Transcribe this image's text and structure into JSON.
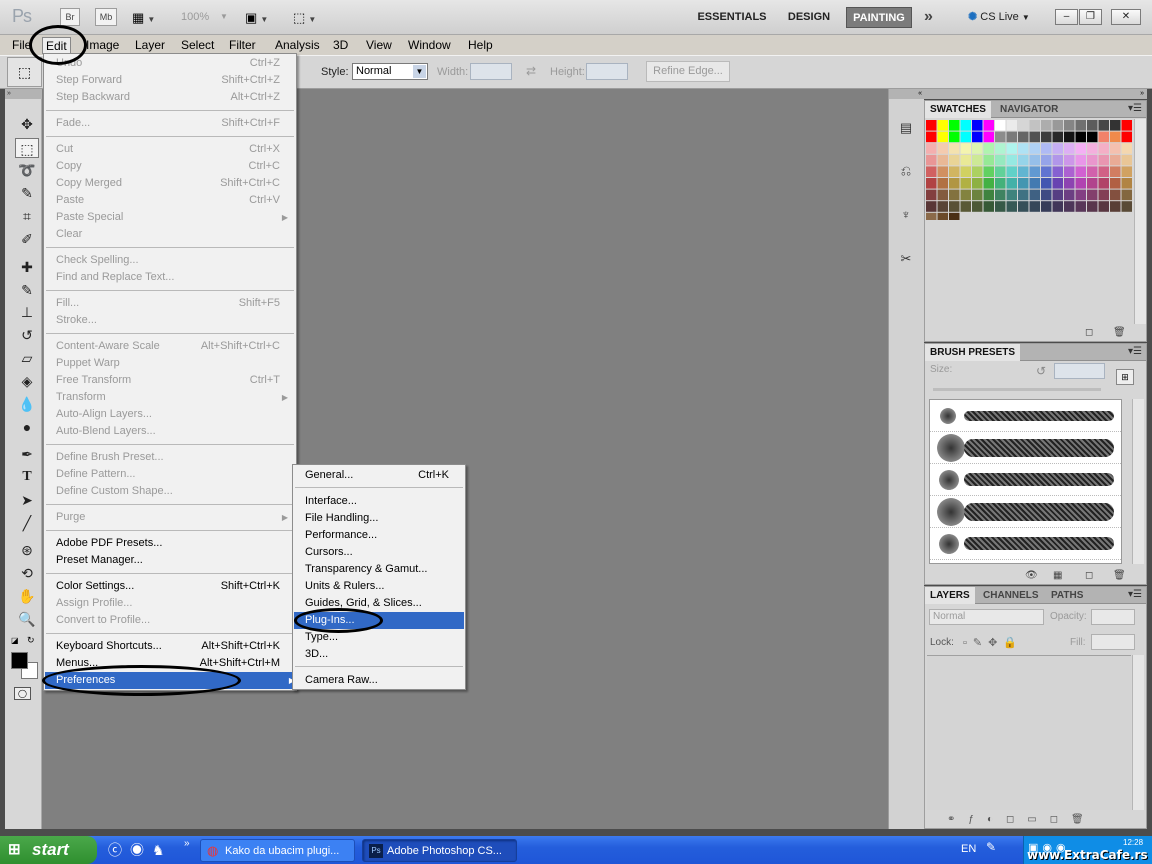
{
  "app": {
    "logo": "Ps",
    "br": "Br",
    "mb": "Mb",
    "zoom": "100%",
    "workspaces": [
      "ESSENTIALS",
      "DESIGN",
      "PAINTING"
    ],
    "active_workspace": "PAINTING",
    "more": "»",
    "cs_live": "CS Live",
    "window_controls": [
      "–",
      "❐",
      "✕"
    ]
  },
  "menubar": [
    "File",
    "Edit",
    "Image",
    "Layer",
    "Select",
    "Filter",
    "Analysis",
    "3D",
    "View",
    "Window",
    "Help"
  ],
  "options": {
    "style_label": "Style:",
    "style_value": "Normal",
    "width_label": "Width:",
    "height_label": "Height:",
    "refine": "Refine Edge..."
  },
  "edit_menu": [
    {
      "label": "Undo",
      "shortcut": "Ctrl+Z",
      "disabled": true
    },
    {
      "label": "Step Forward",
      "shortcut": "Shift+Ctrl+Z",
      "disabled": true
    },
    {
      "label": "Step Backward",
      "shortcut": "Alt+Ctrl+Z",
      "disabled": true
    },
    {
      "label": "Fade...",
      "shortcut": "Shift+Ctrl+F",
      "disabled": true
    },
    {
      "label": "Cut",
      "shortcut": "Ctrl+X",
      "disabled": true
    },
    {
      "label": "Copy",
      "shortcut": "Ctrl+C",
      "disabled": true
    },
    {
      "label": "Copy Merged",
      "shortcut": "Shift+Ctrl+C",
      "disabled": true
    },
    {
      "label": "Paste",
      "shortcut": "Ctrl+V",
      "disabled": true
    },
    {
      "label": "Paste Special",
      "shortcut": "",
      "disabled": true
    },
    {
      "label": "Clear",
      "shortcut": "",
      "disabled": true
    },
    {
      "label": "Check Spelling...",
      "shortcut": "",
      "disabled": true
    },
    {
      "label": "Find and Replace Text...",
      "shortcut": "",
      "disabled": true
    },
    {
      "label": "Fill...",
      "shortcut": "Shift+F5",
      "disabled": true
    },
    {
      "label": "Stroke...",
      "shortcut": "",
      "disabled": true
    },
    {
      "label": "Content-Aware Scale",
      "shortcut": "Alt+Shift+Ctrl+C",
      "disabled": true
    },
    {
      "label": "Puppet Warp",
      "shortcut": "",
      "disabled": true
    },
    {
      "label": "Free Transform",
      "shortcut": "Ctrl+T",
      "disabled": true
    },
    {
      "label": "Transform",
      "shortcut": "",
      "disabled": true
    },
    {
      "label": "Auto-Align Layers...",
      "shortcut": "",
      "disabled": true
    },
    {
      "label": "Auto-Blend Layers...",
      "shortcut": "",
      "disabled": true
    },
    {
      "label": "Define Brush Preset...",
      "shortcut": "",
      "disabled": true
    },
    {
      "label": "Define Pattern...",
      "shortcut": "",
      "disabled": true
    },
    {
      "label": "Define Custom Shape...",
      "shortcut": "",
      "disabled": true
    },
    {
      "label": "Purge",
      "shortcut": "",
      "disabled": true
    },
    {
      "label": "Adobe PDF Presets...",
      "shortcut": "",
      "disabled": false
    },
    {
      "label": "Preset Manager...",
      "shortcut": "",
      "disabled": false
    },
    {
      "label": "Color Settings...",
      "shortcut": "Shift+Ctrl+K",
      "disabled": false
    },
    {
      "label": "Assign Profile...",
      "shortcut": "",
      "disabled": true
    },
    {
      "label": "Convert to Profile...",
      "shortcut": "",
      "disabled": true
    },
    {
      "label": "Keyboard Shortcuts...",
      "shortcut": "Alt+Shift+Ctrl+K",
      "disabled": false
    },
    {
      "label": "Menus...",
      "shortcut": "Alt+Shift+Ctrl+M",
      "disabled": false
    },
    {
      "label": "Preferences",
      "shortcut": "",
      "disabled": false
    }
  ],
  "prefs_menu": [
    {
      "label": "General...",
      "shortcut": "Ctrl+K"
    },
    {
      "label": "Interface...",
      "shortcut": ""
    },
    {
      "label": "File Handling...",
      "shortcut": ""
    },
    {
      "label": "Performance...",
      "shortcut": ""
    },
    {
      "label": "Cursors...",
      "shortcut": ""
    },
    {
      "label": "Transparency & Gamut...",
      "shortcut": ""
    },
    {
      "label": "Units & Rulers...",
      "shortcut": ""
    },
    {
      "label": "Guides, Grid, & Slices...",
      "shortcut": ""
    },
    {
      "label": "Plug-Ins...",
      "shortcut": ""
    },
    {
      "label": "Type...",
      "shortcut": ""
    },
    {
      "label": "3D...",
      "shortcut": ""
    },
    {
      "label": "Camera Raw...",
      "shortcut": ""
    }
  ],
  "panels": {
    "swatches_tabs": [
      "SWATCHES",
      "NAVIGATOR"
    ],
    "brush_tabs": [
      "BRUSH PRESETS"
    ],
    "brush_size_label": "Size:",
    "layers_tabs": [
      "LAYERS",
      "CHANNELS",
      "PATHS"
    ],
    "blend_mode": "Normal",
    "opacity_label": "Opacity:",
    "lock_label": "Lock:",
    "fill_label": "Fill:"
  },
  "taskbar": {
    "start": "start",
    "tasks": [
      "Kako da ubacim plugi...",
      "Adobe Photoshop CS..."
    ],
    "lang": "EN",
    "watermark": "www.ExtraCafe.rs",
    "clock": "12:28"
  },
  "colors": {
    "highlight": "#3169c6",
    "taskbar": "#245edc"
  }
}
